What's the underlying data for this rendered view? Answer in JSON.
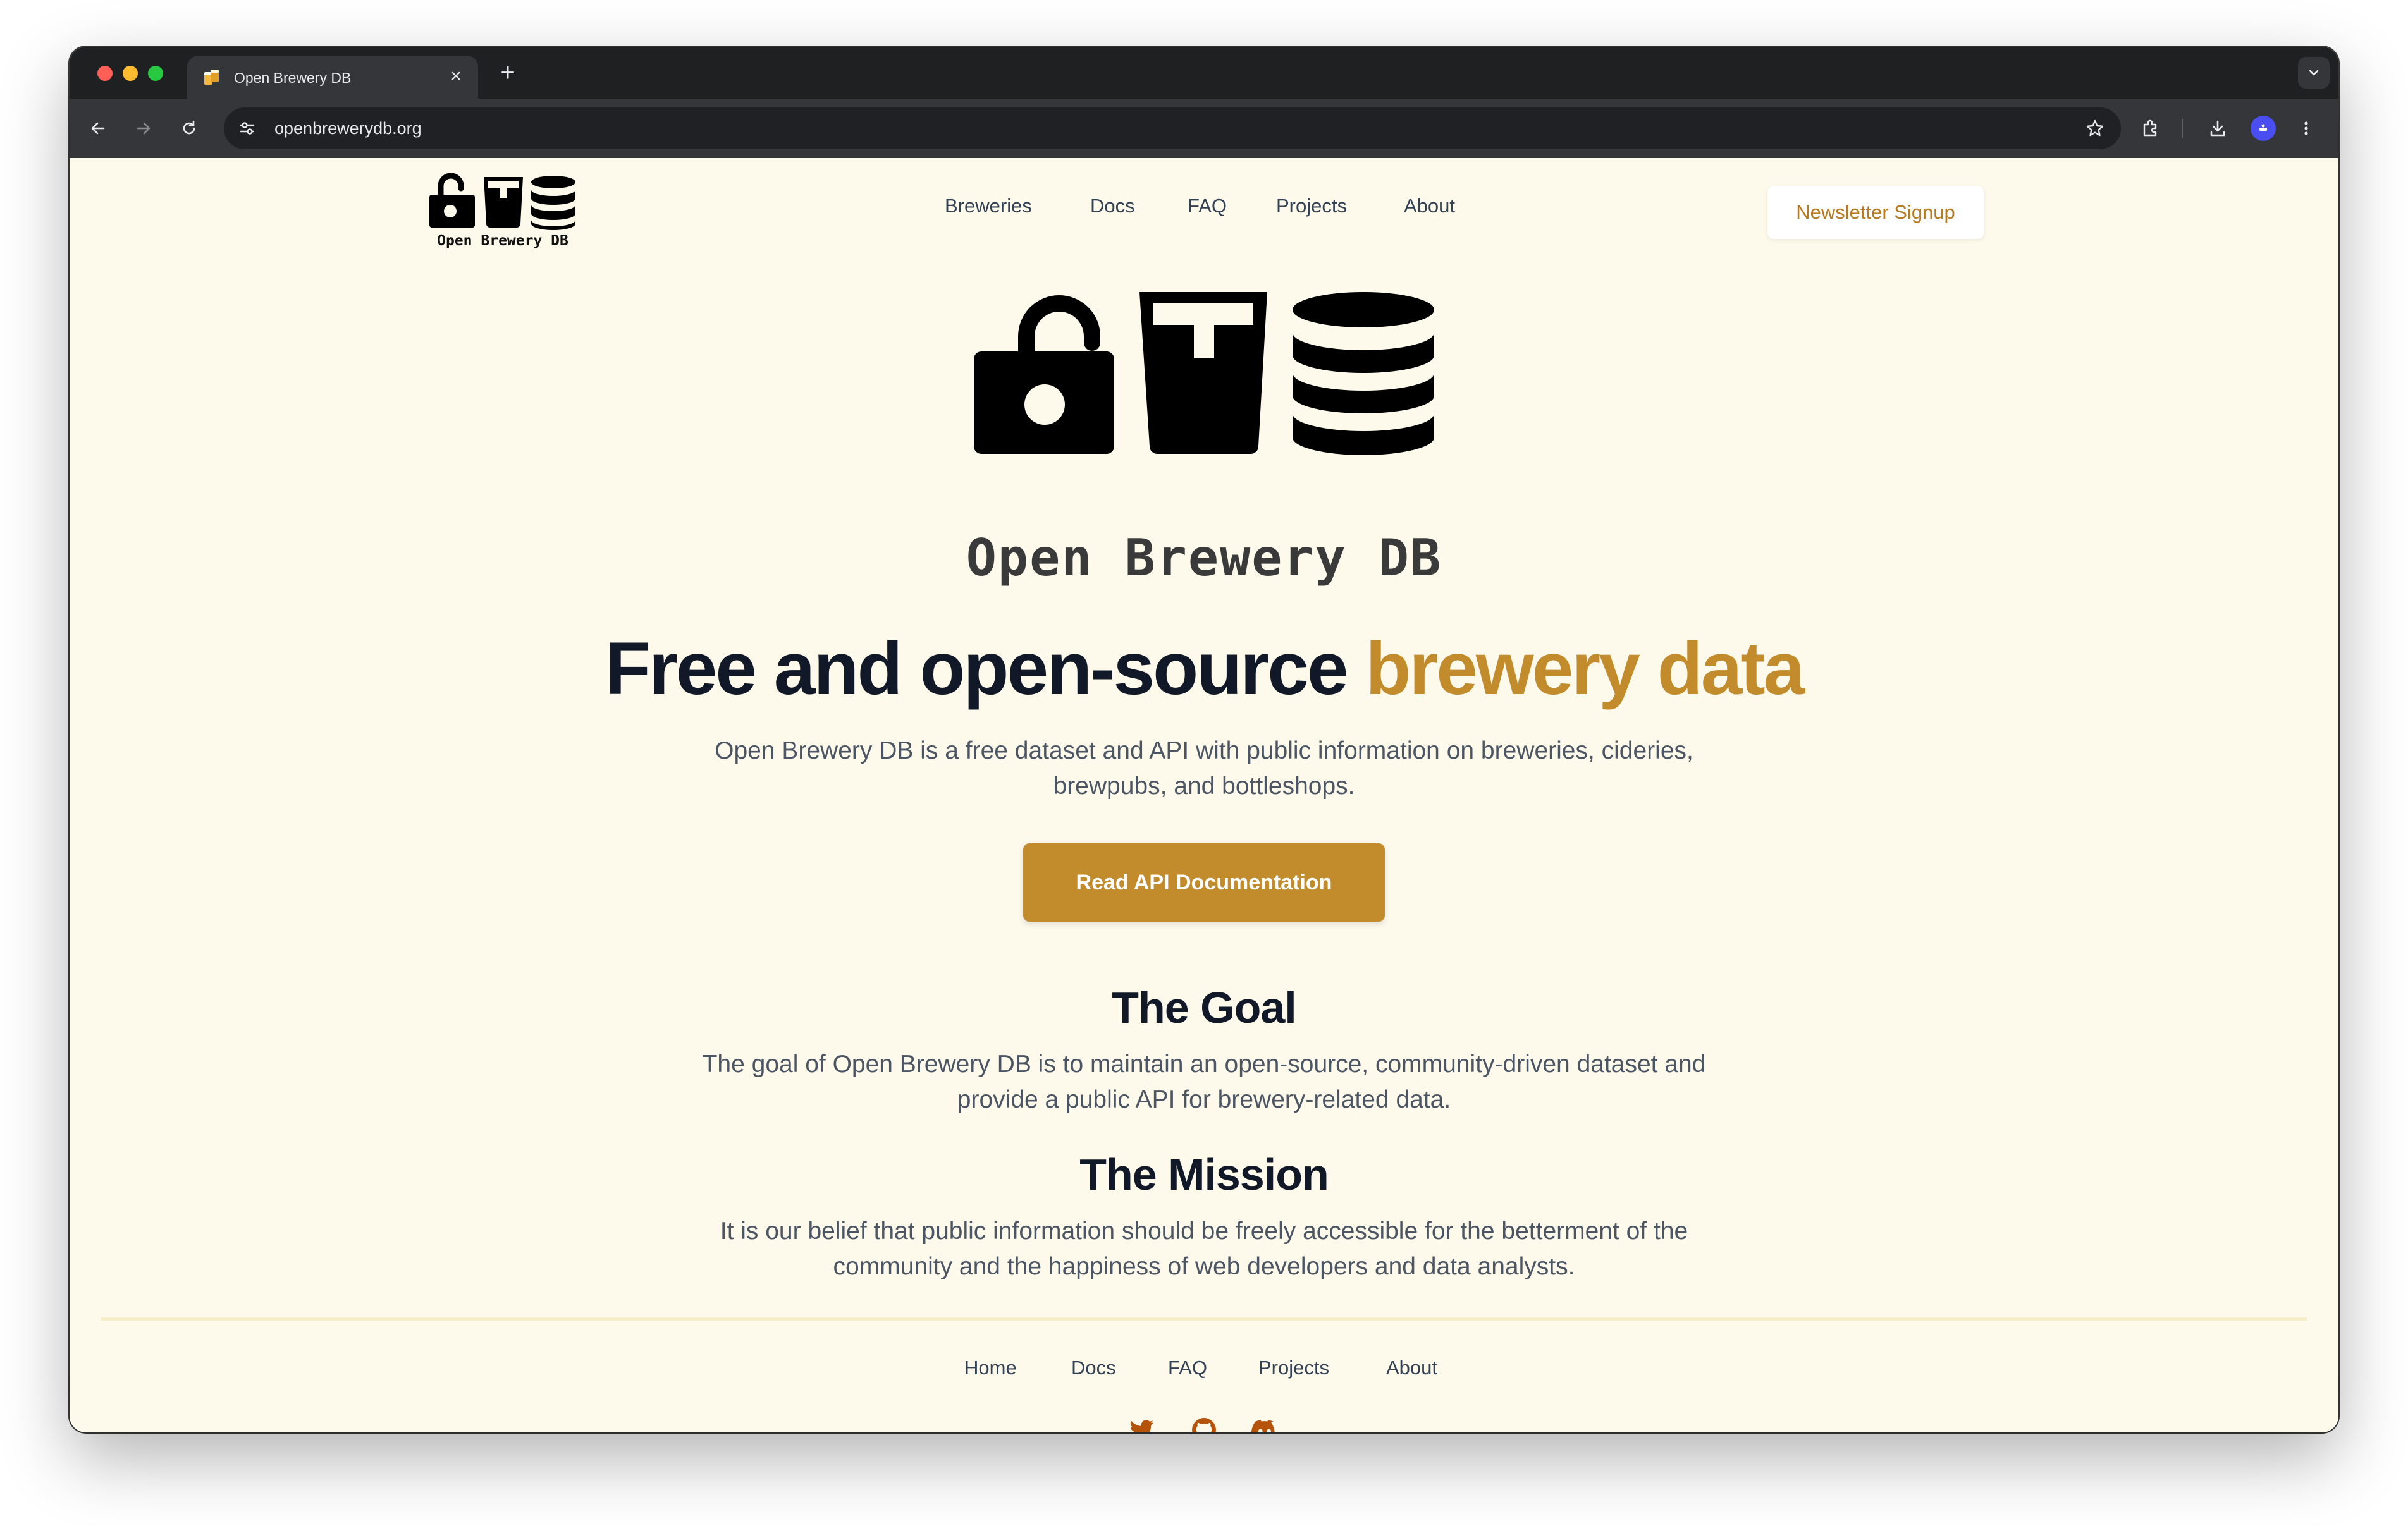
{
  "browser": {
    "tab_title": "Open Brewery DB",
    "url": "openbrewerydb.org",
    "close_glyph": "×",
    "newtab_glyph": "+"
  },
  "header": {
    "logo_text": "Open Brewery DB",
    "nav": [
      "Breweries",
      "Docs",
      "FAQ",
      "Projects",
      "About"
    ],
    "newsletter_label": "Newsletter Signup"
  },
  "hero": {
    "logo_text": "Open Brewery DB",
    "headline_main": "Free and open-source ",
    "headline_accent": "brewery data",
    "subtitle": "Open Brewery DB is a free dataset and API with public information on breweries, cideries, brewpubs, and bottleshops.",
    "cta_label": "Read API Documentation"
  },
  "goal": {
    "title": "The Goal",
    "text": "The goal of Open Brewery DB is to maintain an open-source, community-driven dataset and provide a public API for brewery-related data."
  },
  "mission": {
    "title": "The Mission",
    "text": "It is our belief that public information should be freely accessible for the betterment of the community and the happiness of web developers and data analysts."
  },
  "footer": {
    "nav": [
      "Home",
      "Docs",
      "FAQ",
      "Projects",
      "About"
    ],
    "social_icons": [
      "twitter-icon",
      "github-icon",
      "discord-icon"
    ]
  },
  "colors": {
    "accent": "#c28b2c",
    "page_background": "#fefaeb",
    "social_icon": "#b45309"
  }
}
